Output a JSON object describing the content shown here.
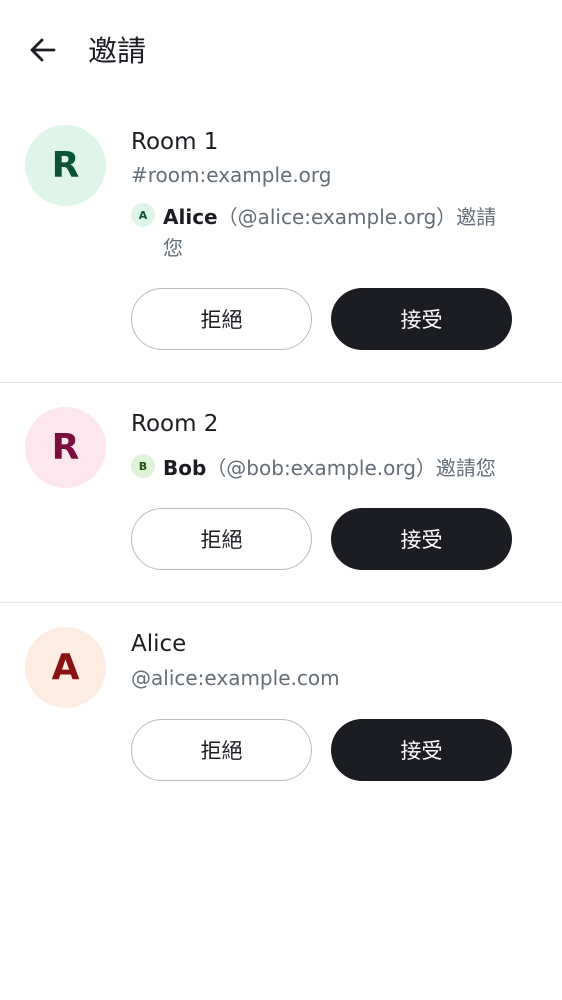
{
  "header": {
    "back_icon": "arrow-left-icon",
    "title": "邀請"
  },
  "invites": [
    {
      "avatar_letter": "R",
      "avatar_bg": "#e0f5e9",
      "avatar_fg": "#0b5437",
      "name": "Room 1",
      "alias": "#room:example.org",
      "inviter": {
        "avatar_letter": "A",
        "avatar_bg": "#e0f5e9",
        "avatar_fg": "#0b5437",
        "name": "Alice",
        "rest": "（@alice:example.org）邀請您"
      },
      "decline_label": "拒絕",
      "accept_label": "接受"
    },
    {
      "avatar_letter": "R",
      "avatar_bg": "#fde6ee",
      "avatar_fg": "#7a0e3e",
      "name": "Room 2",
      "inviter": {
        "avatar_letter": "B",
        "avatar_bg": "#dff3d8",
        "avatar_fg": "#1f5513",
        "name": "Bob",
        "rest": "（@bob:example.org）邀請您"
      },
      "decline_label": "拒絕",
      "accept_label": "接受"
    },
    {
      "avatar_letter": "A",
      "avatar_bg": "#fdece2",
      "avatar_fg": "#8b1010",
      "name": "Alice",
      "alias": "@alice:example.com",
      "decline_label": "拒絕",
      "accept_label": "接受"
    }
  ],
  "colors": {
    "accent_dark": "#1b1d22",
    "secondary_text": "#656d77",
    "divider": "#e3e5e8"
  }
}
